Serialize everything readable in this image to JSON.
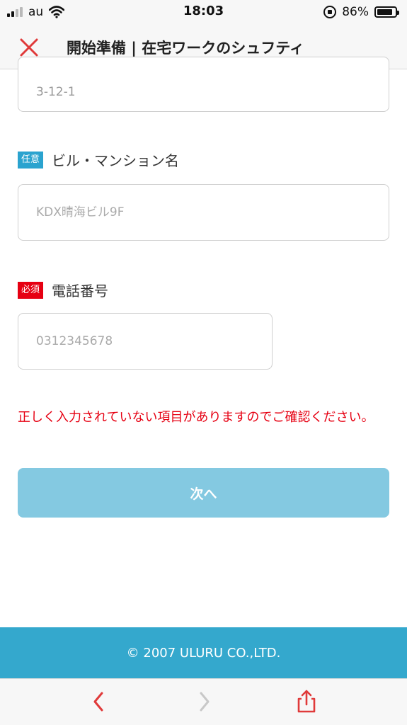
{
  "status_bar": {
    "carrier": "au",
    "time": "18:03",
    "battery_percent": "86%",
    "battery_level": 0.86,
    "icons": [
      "signal-icon",
      "wifi-icon",
      "orientation-lock-icon",
      "battery-icon"
    ]
  },
  "header": {
    "title": "開始準備 | 在宅ワークのシュフティ",
    "close_icon": "close-icon"
  },
  "form": {
    "address_value": "3-12-1",
    "building": {
      "tag": "任意",
      "label": "ビル・マンション名",
      "placeholder": "KDX晴海ビル9F"
    },
    "phone": {
      "tag": "必須",
      "label": "電話番号",
      "placeholder": "0312345678"
    },
    "error_message": "正しく入力されていない項目がありますのでご確認ください。",
    "next_button": "次へ"
  },
  "footer": {
    "copyright": "© 2007 ULURU CO.,LTD."
  },
  "toolbar": {
    "icons": [
      "back-icon",
      "forward-icon",
      "share-icon"
    ]
  },
  "colors": {
    "accent": "#34a8cd",
    "button": "#84c9e1",
    "error": "#e60012",
    "optional_tag": "#2aa3cf",
    "close": "#e03a3a"
  }
}
